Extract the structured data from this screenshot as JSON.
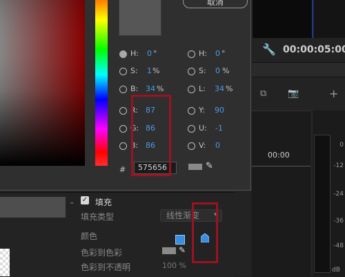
{
  "monitor": {
    "timecode": "00:00:05:00",
    "toolbar_icons": [
      "wrench-icon",
      "clip-icon",
      "camera-icon",
      "plus-icon"
    ]
  },
  "timeline": {
    "time": "00:00"
  },
  "audio_meter": {
    "labels": [
      "0",
      "-12",
      "-24",
      "-36",
      "-48"
    ],
    "unit": "dB"
  },
  "color_picker": {
    "cancel_label": "取消",
    "current_color": "#575656",
    "fields": [
      {
        "label": "H:",
        "value": "0",
        "unit": "°",
        "selected": true
      },
      {
        "label": "S:",
        "value": "1",
        "unit": "%",
        "selected": false
      },
      {
        "label": "B:",
        "value": "34",
        "unit": "%",
        "selected": false
      },
      {
        "label": "R:",
        "value": "87",
        "unit": "",
        "selected": false
      },
      {
        "label": "G:",
        "value": "86",
        "unit": "",
        "selected": false
      },
      {
        "label": "B:",
        "value": "86",
        "unit": "",
        "selected": false
      }
    ],
    "fields_right": [
      {
        "label": "H:",
        "value": "0",
        "unit": "°",
        "selected": false
      },
      {
        "label": "S:",
        "value": "0",
        "unit": "%",
        "selected": false
      },
      {
        "label": "L:",
        "value": "34",
        "unit": "%",
        "selected": false
      },
      {
        "label": "Y:",
        "value": "90",
        "unit": "",
        "selected": false
      },
      {
        "label": "U:",
        "value": "-1",
        "unit": "",
        "selected": false
      },
      {
        "label": "V:",
        "value": "0",
        "unit": "",
        "selected": false
      }
    ],
    "hash": "#",
    "hex_value": "575656"
  },
  "effects": {
    "fill_title": "填充",
    "fill_type_label": "填充类型",
    "fill_type_value": "线性渐变",
    "color_label": "颜色",
    "color_to_color_label": "色彩到色彩",
    "color_to_opacity_label": "色彩到不透明",
    "opacity_value": "100 %"
  },
  "colors": {
    "highlight": "#9c1222",
    "value_blue": "#4d9ae8",
    "swatch_gray": "#575656"
  }
}
